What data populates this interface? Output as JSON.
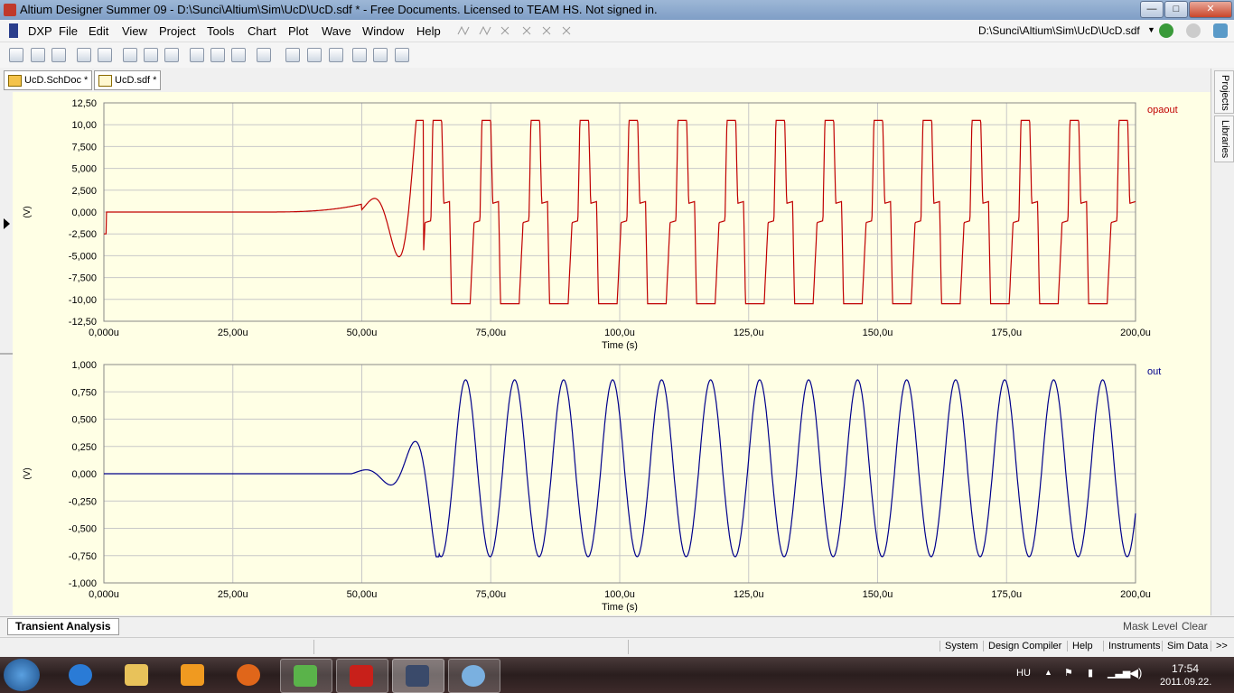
{
  "window": {
    "title": "Altium Designer Summer 09 - D:\\Sunci\\Altium\\Sim\\UcD\\UcD.sdf * - Free Documents. Licensed to TEAM HS. Not signed in.",
    "min_label": "—",
    "max_label": "□",
    "close_label": "✕"
  },
  "menu": [
    "DXP",
    "File",
    "Edit",
    "View",
    "Project",
    "Tools",
    "Chart",
    "Plot",
    "Wave",
    "Window",
    "Help"
  ],
  "path_display": "D:\\Sunci\\Altium\\Sim\\UcD\\UcD.sdf",
  "tabs": [
    {
      "label": "UcD.SchDoc *"
    },
    {
      "label": "UcD.sdf *"
    }
  ],
  "side_tabs": [
    "Projects",
    "Libraries"
  ],
  "charts": [
    {
      "signal": "opaout",
      "color": "#c00000",
      "ylabel": "(V)",
      "xlabel": "Time (s)",
      "yticks": [
        "12,50",
        "10,00",
        "7,500",
        "5,000",
        "2,500",
        "0,000",
        "-2,500",
        "-5,000",
        "-7,500",
        "-10,00",
        "-12,50"
      ],
      "xticks": [
        "0,000u",
        "25,00u",
        "50,00u",
        "75,00u",
        "100,0u",
        "125,0u",
        "150,0u",
        "175,0u",
        "200,0u"
      ]
    },
    {
      "signal": "out",
      "color": "#00008b",
      "ylabel": "(V)",
      "xlabel": "Time (s)",
      "yticks": [
        "1,000",
        "0,750",
        "0,500",
        "0,250",
        "0,000",
        "-0,250",
        "-0,500",
        "-0,750",
        "-1,000"
      ],
      "xticks": [
        "0,000u",
        "25,00u",
        "50,00u",
        "75,00u",
        "100,0u",
        "125,0u",
        "150,0u",
        "175,0u",
        "200,0u"
      ]
    }
  ],
  "chart_data": [
    {
      "type": "line",
      "title": "",
      "xlabel": "Time (s)",
      "ylabel": "(V)",
      "xlim": [
        0,
        200
      ],
      "ylim": [
        -12.5,
        12.5
      ],
      "series": [
        {
          "name": "opaout",
          "description_values": {
            "period_us": 9.5,
            "peak": 10.5,
            "trough": -10.5,
            "onset_us": 50
          }
        }
      ]
    },
    {
      "type": "line",
      "title": "",
      "xlabel": "Time (s)",
      "ylabel": "(V)",
      "xlim": [
        0,
        200
      ],
      "ylim": [
        -1.0,
        1.0
      ],
      "series": [
        {
          "name": "out",
          "description_values": {
            "period_us": 9.5,
            "amplitude": 0.86,
            "onset_us": 50
          }
        }
      ]
    }
  ],
  "bottom": {
    "tab": "Transient Analysis",
    "mask_level": "Mask Level",
    "clear": "Clear"
  },
  "status": [
    "System",
    "Design Compiler",
    "Help",
    "Instruments",
    "Sim Data",
    ">>"
  ],
  "taskbar": {
    "lang": "HU",
    "time": "17:54",
    "date": "2011.09.22."
  }
}
